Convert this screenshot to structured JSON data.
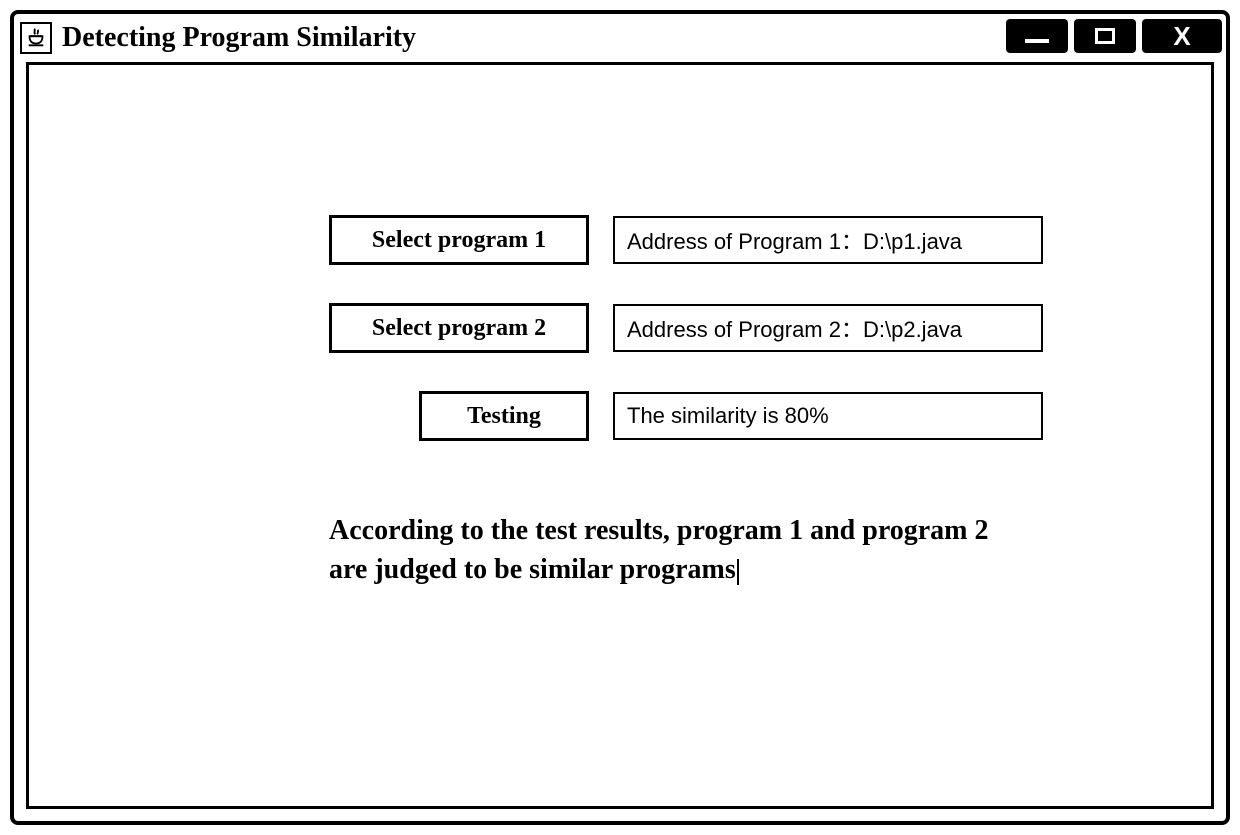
{
  "window": {
    "title": "Detecting Program Similarity"
  },
  "buttons": {
    "select1": "Select program 1",
    "select2": "Select program 2",
    "testing": "Testing"
  },
  "fields": {
    "program1": "Address of Program 1：D:\\p1.java",
    "program2": "Address of Program 2：D:\\p2.java",
    "similarity": "The similarity is 80%"
  },
  "result": "According to the test results, program 1 and program 2 are judged to be similar programs"
}
